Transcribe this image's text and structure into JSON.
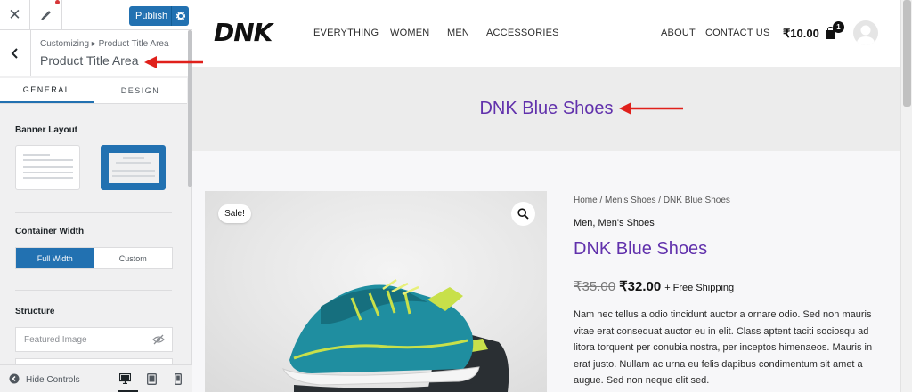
{
  "customizer": {
    "publish_label": "Publish",
    "breadcrumb": "Customizing ▸ Product Title Area",
    "section_title": "Product Title Area",
    "tabs": [
      {
        "label": "GENERAL",
        "active": true
      },
      {
        "label": "DESIGN",
        "active": false
      }
    ],
    "banner_layout_label": "Banner Layout",
    "banner_layout_selected": 2,
    "container_width_label": "Container Width",
    "container_width_options": [
      "Full Width",
      "Custom"
    ],
    "container_width_selected": "Full Width",
    "structure_label": "Structure",
    "structure_items": [
      "Featured Image"
    ],
    "hide_controls_label": "Hide Controls",
    "devices": [
      "desktop",
      "tablet",
      "mobile"
    ],
    "active_device": "desktop"
  },
  "site": {
    "logo": "DNK",
    "nav_left": [
      "EVERYTHING",
      "WOMEN",
      "MEN",
      "ACCESSORIES"
    ],
    "nav_right": [
      "ABOUT",
      "CONTACT US"
    ],
    "cart_total": "₹10.00",
    "cart_count": "1",
    "banner_title": "DNK Blue Shoes",
    "sale_badge": "Sale!",
    "product": {
      "breadcrumb": "Home / Men's Shoes / DNK Blue Shoes",
      "categories": "Men, Men's Shoes",
      "title": "DNK Blue Shoes",
      "old_price": "₹35.00",
      "new_price": "₹32.00",
      "shipping": "+ Free Shipping",
      "description": "Nam nec tellus a odio tincidunt auctor a ornare odio. Sed non mauris vitae erat consequat auctor eu in elit. Class aptent taciti sociosqu ad litora torquent per conubia nostra, per inceptos himenaeos. Mauris in erat justo. Nullam ac urna eu felis dapibus condimentum sit amet a augue. Sed non neque elit sed."
    }
  },
  "colors": {
    "accent_blue": "#2271b1",
    "title_purple": "#6131ac",
    "annotation_red": "#e0201b"
  }
}
